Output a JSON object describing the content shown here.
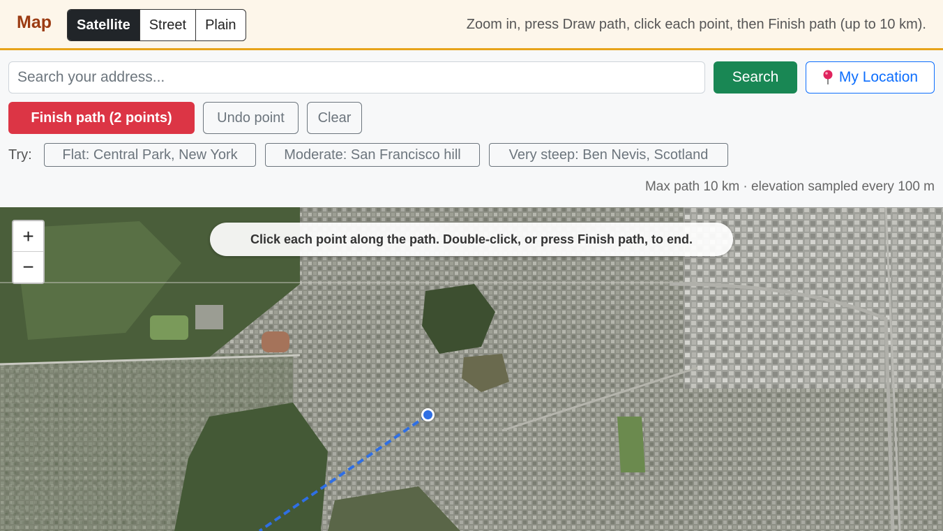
{
  "header": {
    "brand": "Map",
    "map_types": [
      {
        "label": "Satellite",
        "active": true
      },
      {
        "label": "Street",
        "active": false
      },
      {
        "label": "Plain",
        "active": false
      }
    ],
    "hint": "Zoom in, press Draw path, click each point, then Finish path (up to 10 km)."
  },
  "search": {
    "placeholder": "Search your address...",
    "value": "",
    "button_label": "Search",
    "location_label": "My Location",
    "location_icon": "pin-icon"
  },
  "path_controls": {
    "finish_label": "Finish path (2 points)",
    "undo_label": "Undo point",
    "clear_label": "Clear"
  },
  "examples": {
    "label": "Try:",
    "items": [
      "Flat: Central Park, New York",
      "Moderate: San Francisco hill",
      "Very steep: Ben Nevis, Scotland"
    ]
  },
  "footnote": "Max path 10 km · elevation sampled every 100 m",
  "map": {
    "zoom_in": "+",
    "zoom_out": "−",
    "tooltip": "Click each point along the path. Double-click, or press Finish path, to end.",
    "path_color": "#2f6fe4"
  },
  "colors": {
    "accent": "#e7a319",
    "brand": "#9b3b12",
    "search": "#198754",
    "finish": "#dc3545",
    "location": "#0d6efd"
  }
}
